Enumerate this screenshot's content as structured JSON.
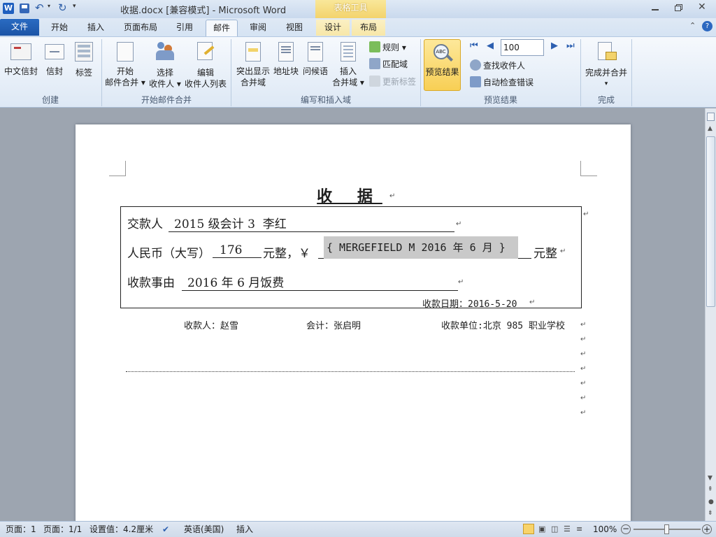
{
  "app": {
    "title": "收据.docx [兼容模式] - Microsoft Word",
    "context_tab_group": "表格工具"
  },
  "quick_access": {
    "icons": [
      "word-logo-icon",
      "save-icon",
      "undo-icon",
      "redo-icon",
      "customize-icon"
    ]
  },
  "tabs": [
    {
      "label": "文件"
    },
    {
      "label": "开始"
    },
    {
      "label": "插入"
    },
    {
      "label": "页面布局"
    },
    {
      "label": "引用"
    },
    {
      "label": "邮件"
    },
    {
      "label": "审阅"
    },
    {
      "label": "视图"
    },
    {
      "label": "设计"
    },
    {
      "label": "布局"
    }
  ],
  "ribbon": {
    "create": {
      "label": "创建",
      "buttons": [
        "中文信封",
        "信封",
        "标签"
      ]
    },
    "start_merge": {
      "label": "开始邮件合并",
      "buttons": [
        {
          "line1": "开始",
          "line2": "邮件合并 ▾"
        },
        {
          "line1": "选择",
          "line2": "收件人 ▾"
        },
        {
          "line1": "编辑",
          "line2": "收件人列表"
        }
      ]
    },
    "write_insert": {
      "label": "编写和插入域",
      "buttons": [
        {
          "line1": "突出显示",
          "line2": "合并域"
        },
        {
          "line1": "地址块",
          "line2": ""
        },
        {
          "line1": "问候语",
          "line2": ""
        },
        {
          "line1": "插入",
          "line2": "合并域 ▾"
        }
      ],
      "small": [
        "规则 ▾",
        "匹配域",
        "更新标签"
      ]
    },
    "preview": {
      "label": "预览结果",
      "button": "预览结果",
      "record": "100",
      "small": [
        "查找收件人",
        "自动检查错误"
      ]
    },
    "finish": {
      "label": "完成",
      "button": "完成并合并",
      "arrow": "▾"
    }
  },
  "document": {
    "title": "收 据",
    "row1_label": "交款人",
    "row1_value": "2015 级会计 3  李红",
    "row2_label": "人民币（大写）",
    "row2_value": "176",
    "row2_mid": "元整，￥",
    "row2_field": "{ MERGEFIELD M 2016 年 6 月 }",
    "row2_end": "元整",
    "row3_label": "收款事由",
    "row3_value": "2016 年 6 月饭费",
    "date": "收款日期：2016-5-20",
    "payee": "收款人：赵雪",
    "accountant": "会计：张启明",
    "unit": "收款单位:北京 985 职业学校"
  },
  "status": {
    "page": "页面：1",
    "pages": "页面：1/1",
    "setting": "设置值：4.2厘米",
    "language": "英语(美国)",
    "mode": "插入",
    "zoom": "100%"
  }
}
